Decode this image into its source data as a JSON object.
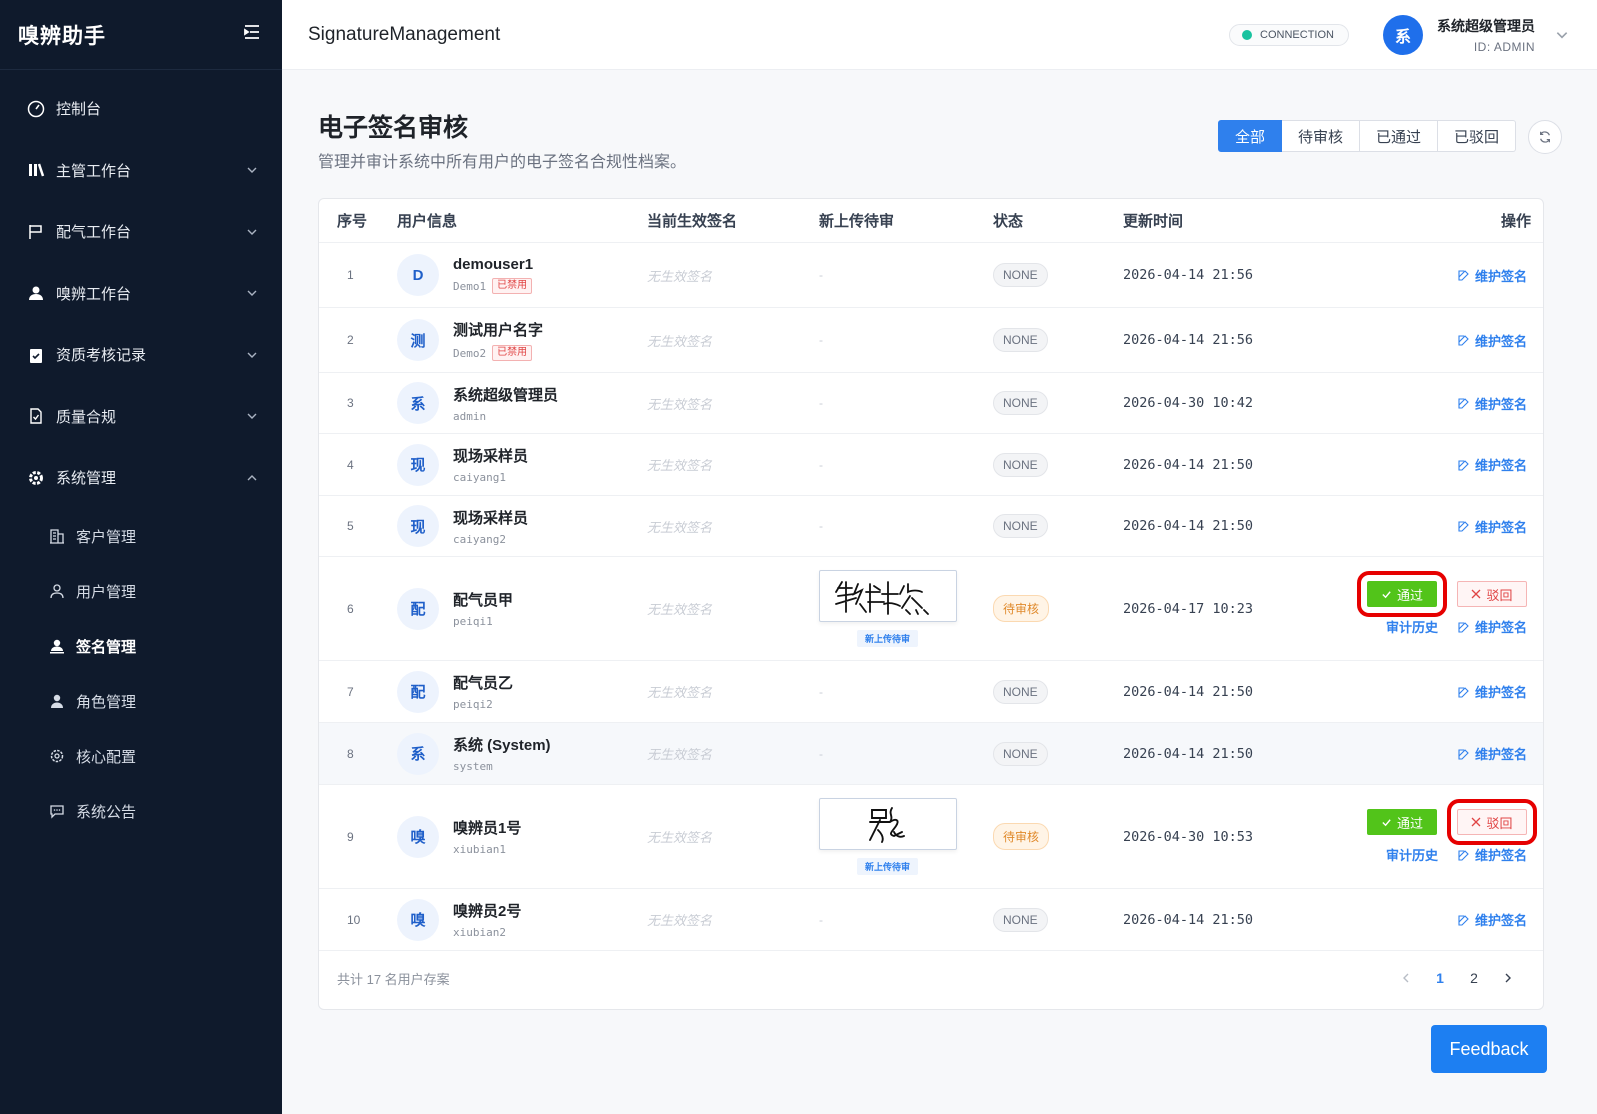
{
  "app": {
    "title": "嗅辨助手"
  },
  "sidebar": {
    "items": [
      {
        "label": "控制台",
        "icon": "dashboard-icon"
      },
      {
        "label": "主管工作台",
        "icon": "chart-icon"
      },
      {
        "label": "配气工作台",
        "icon": "flag-icon"
      },
      {
        "label": "嗅辨工作台",
        "icon": "user-icon"
      },
      {
        "label": "资质考核记录",
        "icon": "clipboard-icon"
      },
      {
        "label": "质量合规",
        "icon": "file-check-icon"
      },
      {
        "label": "系统管理",
        "icon": "gear-icon"
      }
    ],
    "sub_items": [
      {
        "label": "客户管理",
        "icon": "building-icon"
      },
      {
        "label": "用户管理",
        "icon": "user-outline-icon"
      },
      {
        "label": "签名管理",
        "icon": "signature-icon",
        "active": true
      },
      {
        "label": "角色管理",
        "icon": "role-icon"
      },
      {
        "label": "核心配置",
        "icon": "settings-icon"
      },
      {
        "label": "系统公告",
        "icon": "message-icon"
      }
    ]
  },
  "header": {
    "breadcrumb": "SignatureManagement",
    "connection": "CONNECTION",
    "user_avatar": "系",
    "user_name": "系统超级管理员",
    "user_id": "ID: ADMIN"
  },
  "page": {
    "title": "电子签名审核",
    "subtitle": "管理并审计系统中所有用户的电子签名合规性档案。",
    "filters": [
      "全部",
      "待审核",
      "已通过",
      "已驳回"
    ],
    "active_filter": "全部"
  },
  "table": {
    "headers": [
      "序号",
      "用户信息",
      "当前生效签名",
      "新上传待审",
      "状态",
      "更新时间",
      "操作"
    ],
    "no_sig": "无生效签名",
    "dash": "-",
    "maintain": "维护签名",
    "pass": "通过",
    "reject": "驳回",
    "history": "审计历史",
    "new_tag": "新上传待审",
    "rows": [
      {
        "idx": "1",
        "av": "D",
        "name": "demouser1",
        "acct": "Demo1",
        "ban": "已禁用",
        "status": "NONE",
        "time": "2026-04-14 21:56"
      },
      {
        "idx": "2",
        "av": "测",
        "name": "测试用户名字",
        "acct": "Demo2",
        "ban": "已禁用",
        "status": "NONE",
        "time": "2026-04-14 21:56"
      },
      {
        "idx": "3",
        "av": "系",
        "name": "系统超级管理员",
        "acct": "admin",
        "status": "NONE",
        "time": "2026-04-30 10:42"
      },
      {
        "idx": "4",
        "av": "现",
        "name": "现场采样员",
        "acct": "caiyang1",
        "status": "NONE",
        "time": "2026-04-14 21:50"
      },
      {
        "idx": "5",
        "av": "现",
        "name": "现场采样员",
        "acct": "caiyang2",
        "status": "NONE",
        "time": "2026-04-14 21:50"
      },
      {
        "idx": "6",
        "av": "配",
        "name": "配气员甲",
        "acct": "peiqi1",
        "status": "待审核",
        "time": "2026-04-17 10:23",
        "pending": true
      },
      {
        "idx": "7",
        "av": "配",
        "name": "配气员乙",
        "acct": "peiqi2",
        "status": "NONE",
        "time": "2026-04-14 21:50"
      },
      {
        "idx": "8",
        "av": "系",
        "name": "系统 (System)",
        "acct": "system",
        "status": "NONE",
        "time": "2026-04-14 21:50"
      },
      {
        "idx": "9",
        "av": "嗅",
        "name": "嗅辨员1号",
        "acct": "xiubian1",
        "status": "待审核",
        "time": "2026-04-30 10:53",
        "pending": true
      },
      {
        "idx": "10",
        "av": "嗅",
        "name": "嗅辨员2号",
        "acct": "xiubian2",
        "status": "NONE",
        "time": "2026-04-14 21:50"
      }
    ]
  },
  "footer": {
    "total": "共计 17 名用户存案",
    "pages": [
      "1",
      "2"
    ],
    "current_page": "1"
  },
  "feedback": "Feedback",
  "colors": {
    "sidebar": "#0f1a2c",
    "primary": "#2f80ed",
    "pass": "#52c41a",
    "reject": "#e04545",
    "highlight": "#e60000"
  }
}
